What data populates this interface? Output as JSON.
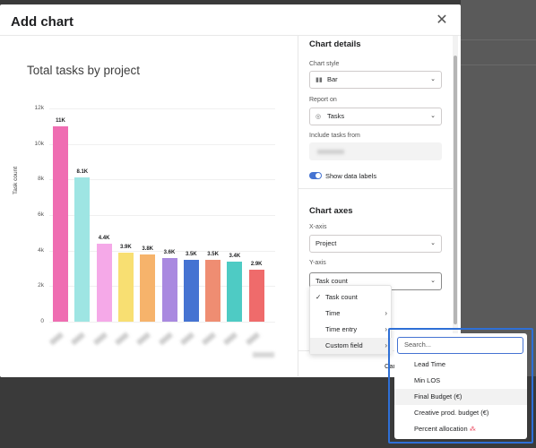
{
  "modal": {
    "title": "Add chart",
    "close_icon": "close-icon"
  },
  "chart_title": "Total tasks by project",
  "chart_data": {
    "type": "bar",
    "title": "Total tasks by project",
    "ylabel": "Task count",
    "ylim": [
      0,
      12000
    ],
    "yticks": [
      "0",
      "2k",
      "4k",
      "6k",
      "8k",
      "10k",
      "12k"
    ],
    "data_labels_shown": true,
    "values": [
      11000,
      8100,
      4400,
      3900,
      3800,
      3600,
      3500,
      3500,
      3400,
      2900
    ],
    "labels": [
      "11K",
      "8.1K",
      "4.4K",
      "3.9K",
      "3.8K",
      "3.6K",
      "3.5K",
      "3.5K",
      "3.4K",
      "2.9K"
    ],
    "colors": [
      "#ef6db2",
      "#9ee5e3",
      "#f5a9e8",
      "#f8df72",
      "#f6b36b",
      "#a989e0",
      "#4573d2",
      "#ef8d72",
      "#4ecbc4",
      "#ef6b6b"
    ]
  },
  "panel": {
    "details_title": "Chart details",
    "chart_style_label": "Chart style",
    "chart_style_value": "Bar",
    "chart_style_icon": "bar-chart-icon",
    "report_on_label": "Report on",
    "report_on_value": "Tasks",
    "report_on_icon": "check-circle-icon",
    "include_from_label": "Include tasks from",
    "show_labels_text": "Show data labels",
    "show_labels_on": true,
    "axes_title": "Chart axes",
    "x_axis_label": "X-axis",
    "x_axis_value": "Project",
    "y_axis_label": "Y-axis",
    "y_axis_value": "Task count",
    "cancel_peek": "Car"
  },
  "menu": {
    "items": [
      {
        "label": "Task count",
        "checked": true,
        "submenu": false
      },
      {
        "label": "Time",
        "checked": false,
        "submenu": true
      },
      {
        "label": "Time entry",
        "checked": false,
        "submenu": true
      },
      {
        "label": "Custom field",
        "checked": false,
        "submenu": true
      }
    ]
  },
  "submenu": {
    "search_placeholder": "Search...",
    "items": [
      "Lead Time",
      "Min LOS",
      "Final Budget (€)",
      "Creative prod. budget (€)",
      "Percent allocation"
    ],
    "star": "⁂"
  },
  "accent": "#4573d2",
  "highlight_color": "#2e6fd6"
}
